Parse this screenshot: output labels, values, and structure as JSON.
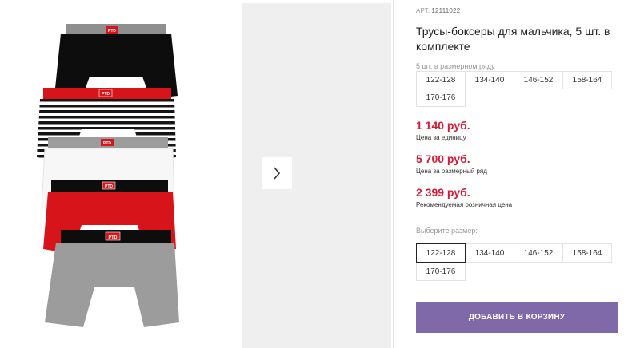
{
  "product": {
    "sku_label": "АРТ.",
    "sku": "12111022",
    "title": "Трусы-боксеры для мальчика, 5 шт. в комплекте",
    "pack_label": "5 шт. в размерном ряду",
    "pack_sizes": [
      "122-128",
      "134-140",
      "146-152",
      "158-164",
      "170-176"
    ],
    "brand_tag": "PTD",
    "images": {
      "colors": {
        "black": "#0d0d0d",
        "red": "#d8141b",
        "white": "#f7f7f7",
        "grey": "#9c9c9c",
        "grey_band": "#8a8a8a"
      }
    }
  },
  "prices": [
    {
      "value": "1 140 руб.",
      "label": "Цена за единицу"
    },
    {
      "value": "5 700 руб.",
      "label": "Цена за размерный ряд"
    },
    {
      "value": "2 399 руб.",
      "label": "Рекомендуемая розничная цена"
    }
  ],
  "size_select": {
    "label": "Выберите размер:",
    "options": [
      "122-128",
      "134-140",
      "146-152",
      "158-164",
      "170-176"
    ],
    "selected": "122-128"
  },
  "gallery": {
    "next_icon": "chevron-right-icon"
  },
  "cart": {
    "add_label": "ДОБАВИТЬ В КОРЗИНУ",
    "color": "#7f69a9"
  },
  "theme": {
    "price_color": "#d51b37",
    "selected_border": "#222222"
  }
}
